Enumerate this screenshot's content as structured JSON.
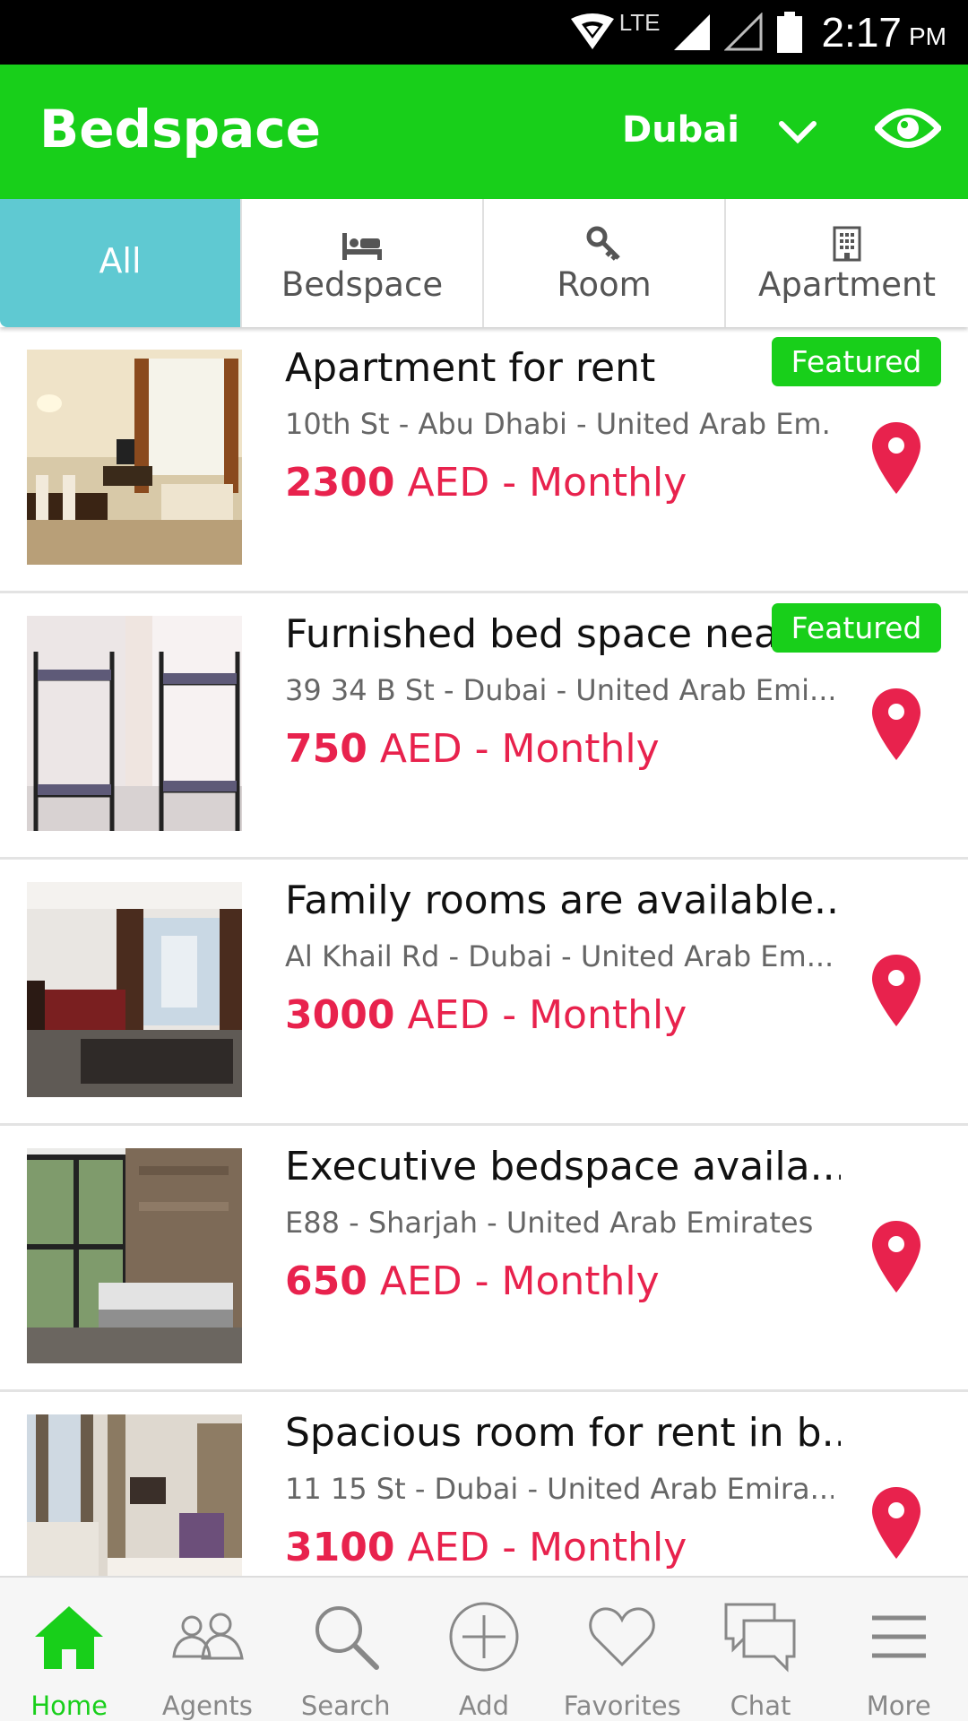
{
  "status_bar": {
    "network": "LTE",
    "time": "2:17",
    "ampm": "PM"
  },
  "app_bar": {
    "title": "Bedspace",
    "city": "Dubai"
  },
  "tabs": [
    {
      "label": "All",
      "active": true
    },
    {
      "label": "Bedspace",
      "icon": "bed-icon"
    },
    {
      "label": "Room",
      "icon": "key-icon"
    },
    {
      "label": "Apartment",
      "icon": "building-icon"
    }
  ],
  "listings": [
    {
      "title": "Apartment for rent",
      "address": "10th St - Abu Dhabi - United Arab Em..",
      "price_amount": "2300",
      "price_suffix": " AED - Monthly",
      "featured": "Featured"
    },
    {
      "title": "Furnished bed space near",
      "address": "39 34 B St - Dubai - United Arab Emi...",
      "price_amount": "750",
      "price_suffix": " AED - Monthly",
      "featured": "Featured"
    },
    {
      "title": "Family rooms are available...",
      "address": "Al Khail Rd - Dubai - United Arab Em...",
      "price_amount": "3000",
      "price_suffix": " AED - Monthly"
    },
    {
      "title": "Executive bedspace availa...",
      "address": "E88 - Sharjah - United Arab Emirates",
      "price_amount": "650",
      "price_suffix": " AED - Monthly"
    },
    {
      "title": "Spacious room for rent in b..",
      "address": "11 15 St - Dubai - United Arab Emira...",
      "price_amount": "3100",
      "price_suffix": " AED - Monthly"
    }
  ],
  "bottom_nav": [
    {
      "label": "Home",
      "icon": "home-icon",
      "active": true
    },
    {
      "label": "Agents",
      "icon": "agents-icon"
    },
    {
      "label": "Search",
      "icon": "search-icon"
    },
    {
      "label": "Add",
      "icon": "add-icon"
    },
    {
      "label": "Favorites",
      "icon": "heart-icon"
    },
    {
      "label": "Chat",
      "icon": "chat-icon"
    },
    {
      "label": "More",
      "icon": "menu-icon"
    }
  ],
  "colors": {
    "brand_green": "#18cf1a",
    "active_tab": "#5fc9d2",
    "price_red": "#e8224d"
  }
}
